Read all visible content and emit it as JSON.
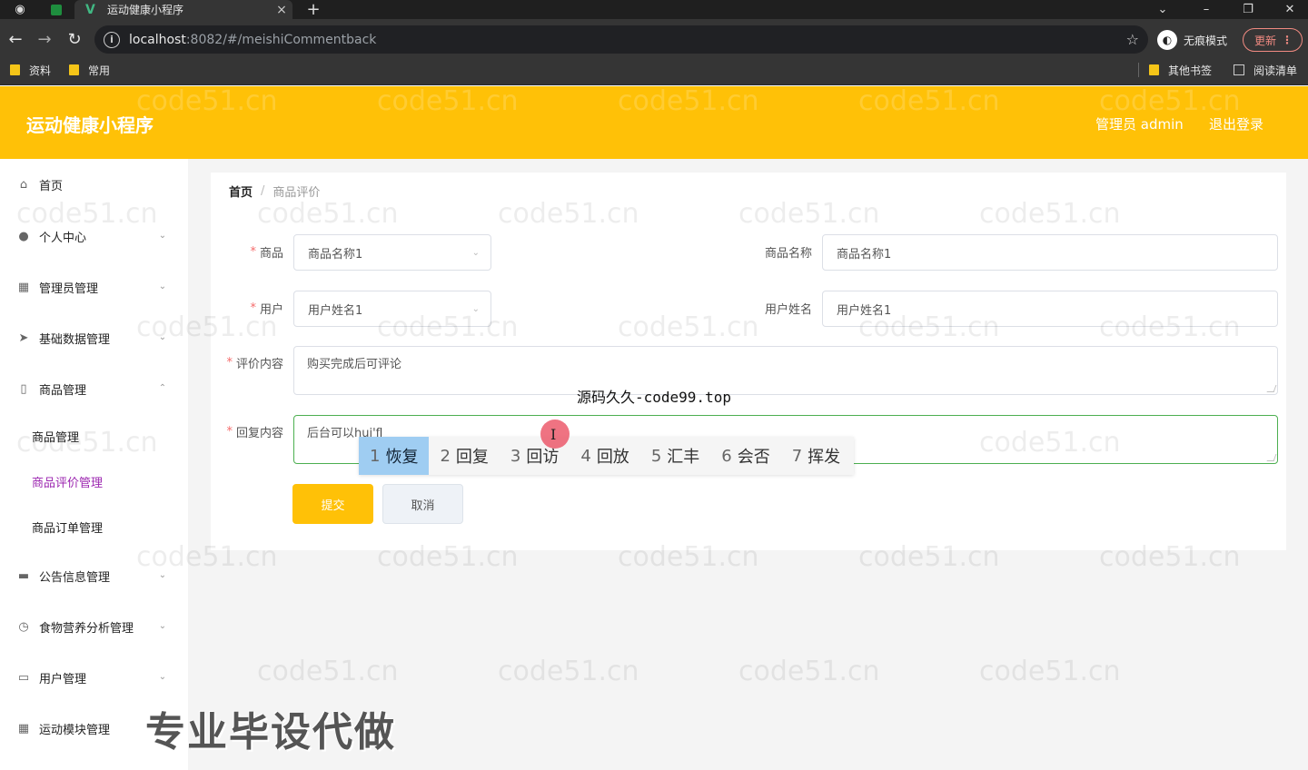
{
  "browser": {
    "tab_title": "运动健康小程序",
    "new_tab": "+",
    "url_host": "localhost",
    "url_rest": ":8082/#/meishiCommentback",
    "incognito_label": "无痕模式",
    "update_label": "更新",
    "bookmarks": [
      "资料",
      "常用"
    ],
    "bookmarks_right": [
      "其他书签",
      "阅读清单"
    ]
  },
  "header": {
    "app_title": "运动健康小程序",
    "admin_label": "管理员 admin",
    "logout_label": "退出登录"
  },
  "sidebar": {
    "items": [
      {
        "label": "首页",
        "icon": "home-icon"
      },
      {
        "label": "个人中心",
        "icon": "user-icon"
      },
      {
        "label": "管理员管理",
        "icon": "grid-icon"
      },
      {
        "label": "基础数据管理",
        "icon": "send-icon"
      },
      {
        "label": "商品管理",
        "icon": "phone-icon"
      },
      {
        "label": "公告信息管理",
        "icon": "briefcase-icon"
      },
      {
        "label": "食物营养分析管理",
        "icon": "clock-icon"
      },
      {
        "label": "用户管理",
        "icon": "chat-icon"
      },
      {
        "label": "运动模块管理",
        "icon": "apps-icon"
      }
    ],
    "sub_items": [
      "商品管理",
      "商品评价管理",
      "商品订单管理"
    ]
  },
  "breadcrumb": {
    "home": "首页",
    "separator": "/",
    "current": "商品评价"
  },
  "form": {
    "product_label": "商品",
    "product_value": "商品名称1",
    "product_name_label": "商品名称",
    "product_name_value": "商品名称1",
    "user_label": "用户",
    "user_value": "用户姓名1",
    "user_name_label": "用户姓名",
    "user_name_value": "用户姓名1",
    "comment_label": "评价内容",
    "comment_value": "购买完成后可评论",
    "reply_label": "回复内容",
    "reply_value": "后台可以hui'f",
    "required_mark": "*",
    "submit_label": "提交",
    "cancel_label": "取消"
  },
  "ime": {
    "candidates": [
      {
        "n": "1",
        "text": "恢复"
      },
      {
        "n": "2",
        "text": "回复"
      },
      {
        "n": "3",
        "text": "回访"
      },
      {
        "n": "4",
        "text": "回放"
      },
      {
        "n": "5",
        "text": "汇丰"
      },
      {
        "n": "6",
        "text": "会否"
      },
      {
        "n": "7",
        "text": "挥发"
      }
    ]
  },
  "overlay": {
    "source_text": "源码久久-code99.top",
    "promo_text": "专业毕设代做",
    "watermark": "code51.cn"
  }
}
